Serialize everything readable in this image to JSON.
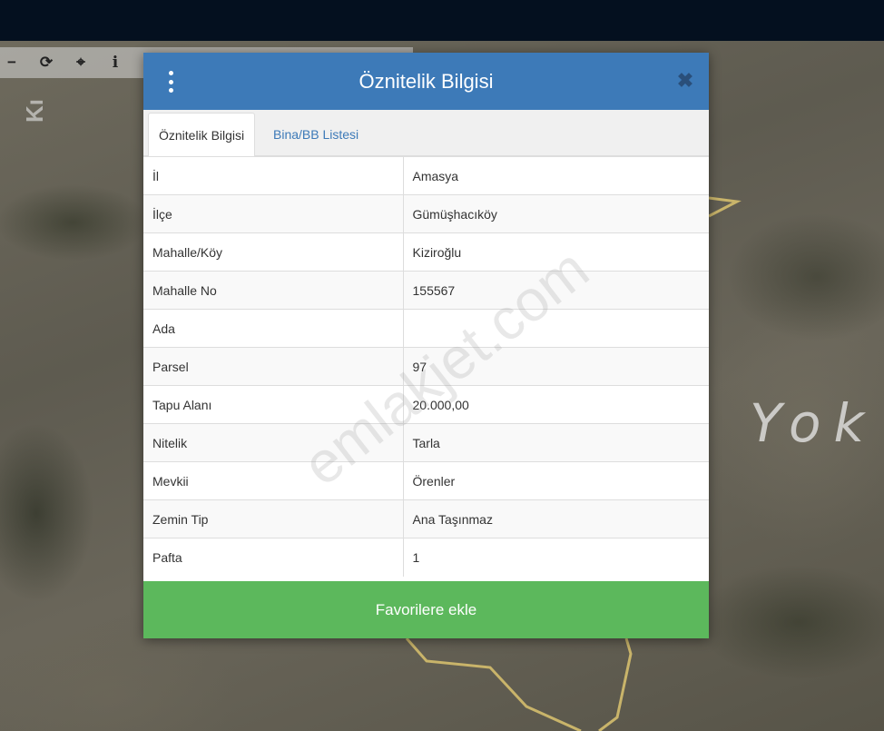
{
  "colors": {
    "header": "#3d7ab8",
    "topbar": "#04101f",
    "favorite_button": "#5cb85c",
    "tab_link": "#3d7ab8"
  },
  "map": {
    "label_right": "Yok"
  },
  "map_toolbar": {
    "tools": [
      {
        "icon": "minus-icon",
        "glyph": "−"
      },
      {
        "icon": "refresh-icon",
        "glyph": "⟳"
      },
      {
        "icon": "crosshair-icon",
        "glyph": "⌖"
      },
      {
        "icon": "info-icon",
        "glyph": "i"
      }
    ]
  },
  "modal": {
    "title": "Öznitelik Bilgisi",
    "menu_icon": "vertical-dots-icon",
    "close_icon": "close-icon",
    "close_glyph": "✖",
    "tabs": [
      {
        "label": "Öznitelik Bilgisi",
        "active": true
      },
      {
        "label": "Bina/BB Listesi",
        "active": false
      }
    ],
    "rows": [
      {
        "key": "İl",
        "value": "Amasya"
      },
      {
        "key": "İlçe",
        "value": "Gümüşhacıköy"
      },
      {
        "key": "Mahalle/Köy",
        "value": "Kiziroğlu"
      },
      {
        "key": "Mahalle No",
        "value": "155567"
      },
      {
        "key": "Ada",
        "value": ""
      },
      {
        "key": "Parsel",
        "value": "97"
      },
      {
        "key": "Tapu Alanı",
        "value": "20.000,00"
      },
      {
        "key": "Nitelik",
        "value": "Tarla"
      },
      {
        "key": "Mevkii",
        "value": "Örenler"
      },
      {
        "key": "Zemin Tip",
        "value": "Ana Taşınmaz"
      },
      {
        "key": "Pafta",
        "value": "1"
      }
    ],
    "favorite_button": "Favorilere ekle"
  },
  "watermark": "emlakjet.com"
}
